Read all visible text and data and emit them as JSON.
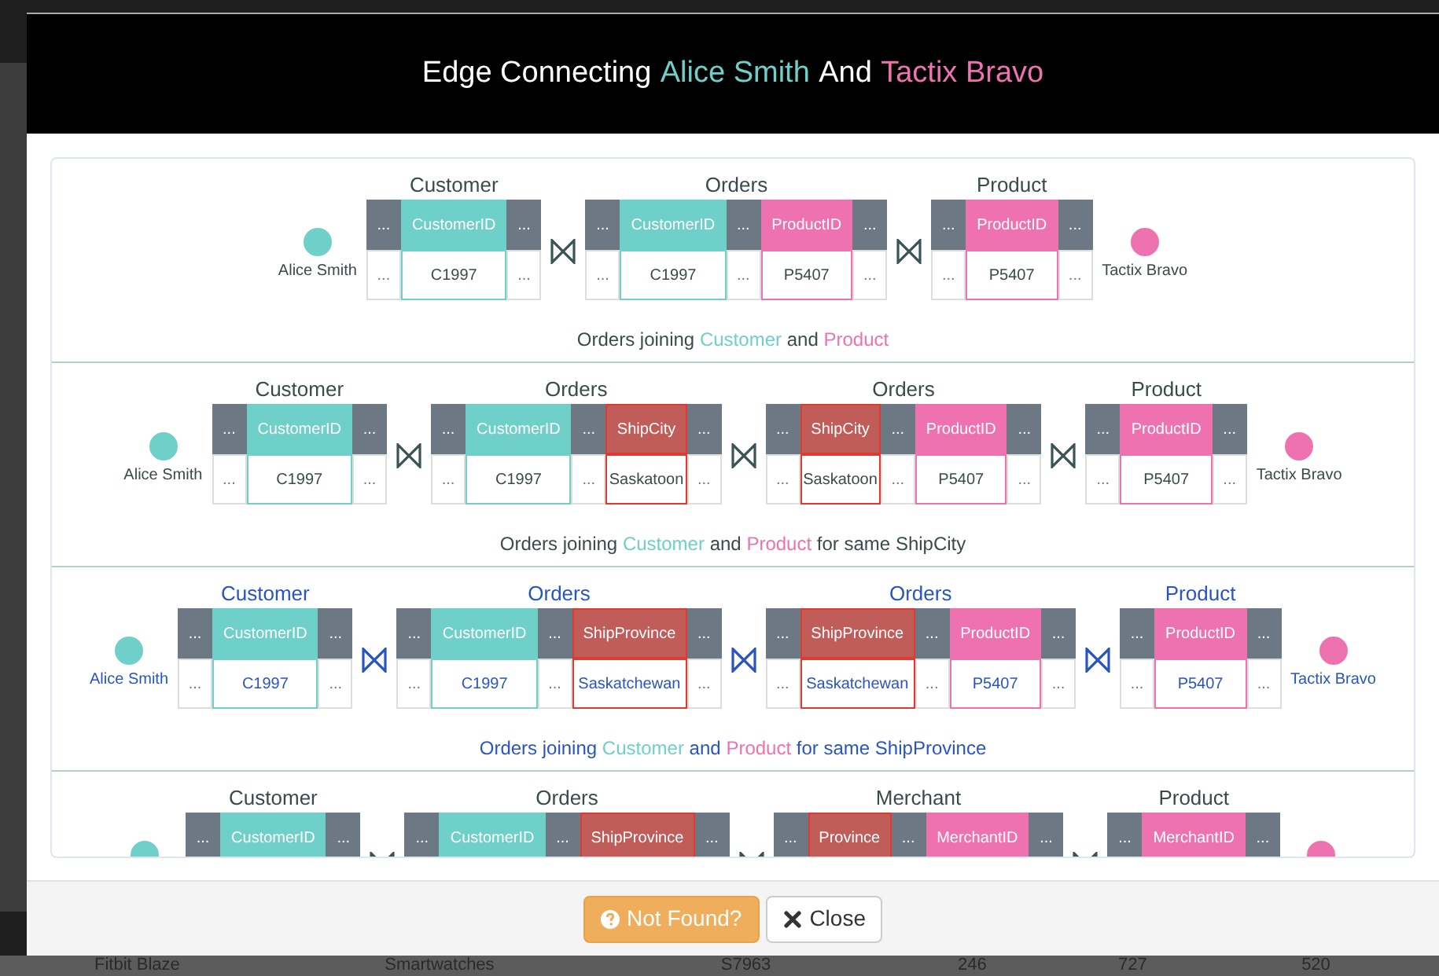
{
  "background_table": {
    "row": [
      "Fitbit Blaze",
      "Smartwatches",
      "S7963",
      "246",
      "727",
      "520"
    ]
  },
  "dialog": {
    "title": [
      {
        "text": "Edge Connecting",
        "kind": "plain"
      },
      {
        "text": "Alice Smith",
        "kind": "source"
      },
      {
        "text": "And",
        "kind": "plain"
      },
      {
        "text": "Tactix Bravo",
        "kind": "target"
      }
    ],
    "paths": [
      {
        "selected": false,
        "source": {
          "label": "Alice Smith"
        },
        "target": {
          "label": "Tactix Bravo"
        },
        "tables": [
          {
            "name": "Customer",
            "columns": [
              {
                "kind": "other",
                "header": "...",
                "value": "..."
              },
              {
                "kind": "source",
                "header": "CustomerID",
                "value": "C1997"
              },
              {
                "kind": "other",
                "header": "...",
                "value": "..."
              }
            ]
          },
          {
            "name": "Orders",
            "columns": [
              {
                "kind": "other",
                "header": "...",
                "value": "..."
              },
              {
                "kind": "source",
                "header": "CustomerID",
                "value": "C1997"
              },
              {
                "kind": "other",
                "header": "...",
                "value": "..."
              },
              {
                "kind": "target",
                "header": "ProductID",
                "value": "P5407"
              },
              {
                "kind": "other",
                "header": "...",
                "value": "..."
              }
            ]
          },
          {
            "name": "Product",
            "columns": [
              {
                "kind": "other",
                "header": "...",
                "value": "..."
              },
              {
                "kind": "target",
                "header": "ProductID",
                "value": "P5407"
              },
              {
                "kind": "other",
                "header": "...",
                "value": "..."
              }
            ]
          }
        ],
        "caption": [
          {
            "text": "Orders joining",
            "kind": "plain"
          },
          {
            "text": "Customer",
            "kind": "source"
          },
          {
            "text": "and",
            "kind": "plain"
          },
          {
            "text": "Product",
            "kind": "target"
          }
        ]
      },
      {
        "selected": false,
        "source": {
          "label": "Alice Smith"
        },
        "target": {
          "label": "Tactix Bravo"
        },
        "tables": [
          {
            "name": "Customer",
            "columns": [
              {
                "kind": "other",
                "header": "...",
                "value": "..."
              },
              {
                "kind": "source",
                "header": "CustomerID",
                "value": "C1997"
              },
              {
                "kind": "other",
                "header": "...",
                "value": "..."
              }
            ]
          },
          {
            "name": "Orders",
            "columns": [
              {
                "kind": "other",
                "header": "...",
                "value": "..."
              },
              {
                "kind": "source",
                "header": "CustomerID",
                "value": "C1997"
              },
              {
                "kind": "other",
                "header": "...",
                "value": "..."
              },
              {
                "kind": "shared",
                "header": "ShipCity",
                "value": "Saskatoon"
              },
              {
                "kind": "other",
                "header": "...",
                "value": "..."
              }
            ]
          },
          {
            "name": "Orders",
            "columns": [
              {
                "kind": "other",
                "header": "...",
                "value": "..."
              },
              {
                "kind": "shared",
                "header": "ShipCity",
                "value": "Saskatoon"
              },
              {
                "kind": "other",
                "header": "...",
                "value": "..."
              },
              {
                "kind": "target",
                "header": "ProductID",
                "value": "P5407"
              },
              {
                "kind": "other",
                "header": "...",
                "value": "..."
              }
            ]
          },
          {
            "name": "Product",
            "columns": [
              {
                "kind": "other",
                "header": "...",
                "value": "..."
              },
              {
                "kind": "target",
                "header": "ProductID",
                "value": "P5407"
              },
              {
                "kind": "other",
                "header": "...",
                "value": "..."
              }
            ]
          }
        ],
        "caption": [
          {
            "text": "Orders joining",
            "kind": "plain"
          },
          {
            "text": "Customer",
            "kind": "source"
          },
          {
            "text": "and",
            "kind": "plain"
          },
          {
            "text": "Product",
            "kind": "target"
          },
          {
            "text": "for same ShipCity",
            "kind": "plain"
          }
        ]
      },
      {
        "selected": true,
        "source": {
          "label": "Alice Smith"
        },
        "target": {
          "label": "Tactix Bravo"
        },
        "tables": [
          {
            "name": "Customer",
            "columns": [
              {
                "kind": "other",
                "header": "...",
                "value": "..."
              },
              {
                "kind": "source",
                "header": "CustomerID",
                "value": "C1997"
              },
              {
                "kind": "other",
                "header": "...",
                "value": "..."
              }
            ]
          },
          {
            "name": "Orders",
            "columns": [
              {
                "kind": "other",
                "header": "...",
                "value": "..."
              },
              {
                "kind": "source",
                "header": "CustomerID",
                "value": "C1997"
              },
              {
                "kind": "other",
                "header": "...",
                "value": "..."
              },
              {
                "kind": "shared",
                "header": "ShipProvince",
                "value": "Saskatchewan"
              },
              {
                "kind": "other",
                "header": "...",
                "value": "..."
              }
            ]
          },
          {
            "name": "Orders",
            "columns": [
              {
                "kind": "other",
                "header": "...",
                "value": "..."
              },
              {
                "kind": "shared",
                "header": "ShipProvince",
                "value": "Saskatchewan"
              },
              {
                "kind": "other",
                "header": "...",
                "value": "..."
              },
              {
                "kind": "target",
                "header": "ProductID",
                "value": "P5407"
              },
              {
                "kind": "other",
                "header": "...",
                "value": "..."
              }
            ]
          },
          {
            "name": "Product",
            "columns": [
              {
                "kind": "other",
                "header": "...",
                "value": "..."
              },
              {
                "kind": "target",
                "header": "ProductID",
                "value": "P5407"
              },
              {
                "kind": "other",
                "header": "...",
                "value": "..."
              }
            ]
          }
        ],
        "caption": [
          {
            "text": "Orders joining",
            "kind": "plain"
          },
          {
            "text": "Customer",
            "kind": "source"
          },
          {
            "text": "and",
            "kind": "plain"
          },
          {
            "text": "Product",
            "kind": "target"
          },
          {
            "text": "for same ShipProvince",
            "kind": "plain"
          }
        ]
      },
      {
        "selected": false,
        "tables": [
          {
            "name": "Customer",
            "columns": [
              {
                "kind": "other",
                "header": "..."
              },
              {
                "kind": "source",
                "header": "CustomerID"
              },
              {
                "kind": "other",
                "header": "..."
              }
            ]
          },
          {
            "name": "Orders",
            "columns": [
              {
                "kind": "other",
                "header": "..."
              },
              {
                "kind": "source",
                "header": "CustomerID"
              },
              {
                "kind": "other",
                "header": "..."
              },
              {
                "kind": "shared",
                "header": "ShipProvince"
              },
              {
                "kind": "other",
                "header": "..."
              }
            ]
          },
          {
            "name": "Merchant",
            "columns": [
              {
                "kind": "other",
                "header": "..."
              },
              {
                "kind": "shared",
                "header": "Province"
              },
              {
                "kind": "other",
                "header": "..."
              },
              {
                "kind": "target",
                "header": "MerchantID"
              },
              {
                "kind": "other",
                "header": "..."
              }
            ]
          },
          {
            "name": "Product",
            "columns": [
              {
                "kind": "other",
                "header": "..."
              },
              {
                "kind": "target",
                "header": "MerchantID"
              },
              {
                "kind": "other",
                "header": "..."
              }
            ]
          }
        ]
      }
    ],
    "buttons": [
      {
        "label": "Not Found?",
        "kind": "warning"
      },
      {
        "label": "Close",
        "kind": "default"
      }
    ]
  }
}
